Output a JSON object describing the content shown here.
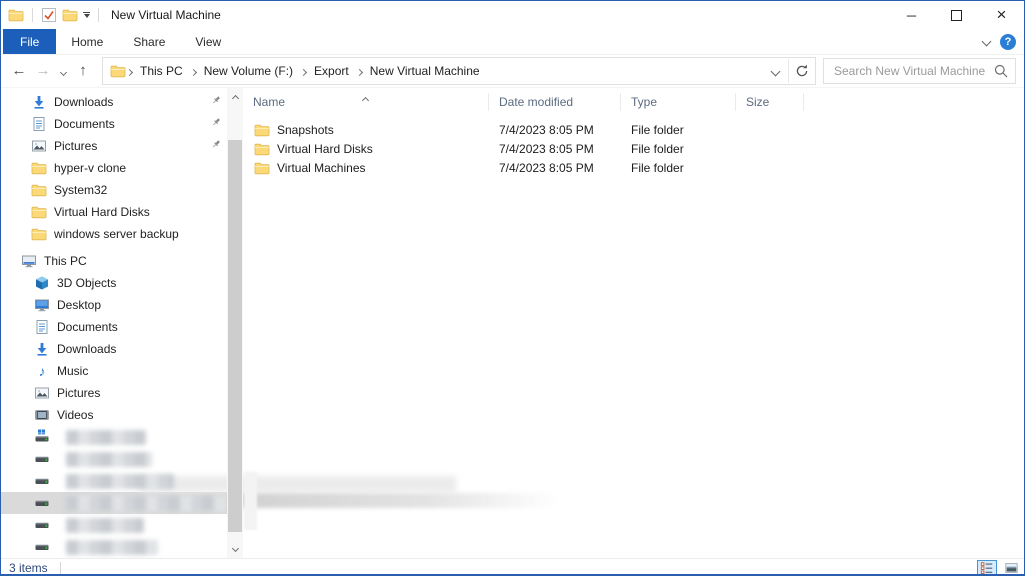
{
  "titlebar": {
    "title": "New Virtual Machine",
    "quick_access_icons": [
      "properties-checkbox-icon",
      "new-folder-icon",
      "customize-toolbar-dropdown"
    ]
  },
  "glyphs": {
    "minimize": "─",
    "close": "×",
    "back": "←",
    "forward": "→",
    "up": "↑",
    "music": "♪",
    "help": "?"
  },
  "ribbon": {
    "tabs": [
      {
        "label": "File",
        "active": true
      },
      {
        "label": "Home",
        "active": false
      },
      {
        "label": "Share",
        "active": false
      },
      {
        "label": "View",
        "active": false
      }
    ]
  },
  "address_bar": {
    "breadcrumb": [
      "This PC",
      "New Volume (F:)",
      "Export",
      "New Virtual Machine"
    ]
  },
  "search": {
    "placeholder": "Search New Virtual Machine"
  },
  "sidebar": {
    "quick_access": [
      {
        "label": "Downloads",
        "icon": "downloads-icon",
        "pinned": true
      },
      {
        "label": "Documents",
        "icon": "documents-icon",
        "pinned": true
      },
      {
        "label": "Pictures",
        "icon": "pictures-icon",
        "pinned": true
      },
      {
        "label": "hyper-v clone",
        "icon": "folder-icon",
        "pinned": false
      },
      {
        "label": "System32",
        "icon": "folder-icon",
        "pinned": false
      },
      {
        "label": "Virtual Hard Disks",
        "icon": "folder-icon",
        "pinned": false
      },
      {
        "label": "windows server backup",
        "icon": "folder-icon",
        "pinned": false
      }
    ],
    "this_pc": {
      "label": "This PC",
      "icon": "computer-icon"
    },
    "this_pc_children": [
      {
        "label": "3D Objects",
        "icon": "cube-icon"
      },
      {
        "label": "Desktop",
        "icon": "desktop-icon"
      },
      {
        "label": "Documents",
        "icon": "documents-icon"
      },
      {
        "label": "Downloads",
        "icon": "downloads-icon"
      },
      {
        "label": "Music",
        "icon": "music-icon"
      },
      {
        "label": "Pictures",
        "icon": "pictures-icon"
      },
      {
        "label": "Videos",
        "icon": "videos-icon"
      }
    ],
    "redacted_drives": {
      "count": 6,
      "selected_index": 3,
      "first_is_system_drive": true
    }
  },
  "file_list": {
    "columns": [
      {
        "label": "Name",
        "sorted": "asc"
      },
      {
        "label": "Date modified",
        "sorted": null
      },
      {
        "label": "Type",
        "sorted": null
      },
      {
        "label": "Size",
        "sorted": null
      }
    ],
    "rows": [
      {
        "name": "Snapshots",
        "date_modified": "7/4/2023 8:05 PM",
        "type": "File folder",
        "size": ""
      },
      {
        "name": "Virtual Hard Disks",
        "date_modified": "7/4/2023 8:05 PM",
        "type": "File folder",
        "size": ""
      },
      {
        "name": "Virtual Machines",
        "date_modified": "7/4/2023 8:05 PM",
        "type": "File folder",
        "size": ""
      }
    ]
  },
  "status_bar": {
    "items_count": "3 items",
    "view_buttons": [
      "details-view",
      "thumbnails-view"
    ],
    "active_view": "details-view"
  },
  "colors": {
    "accent_tab": "#1c5fbb",
    "window_border": "#2a5fb0",
    "folder_yellow": "#fbd978",
    "selection_gray": "#dadada",
    "header_text": "#5b6b80",
    "status_text": "#30487a"
  }
}
